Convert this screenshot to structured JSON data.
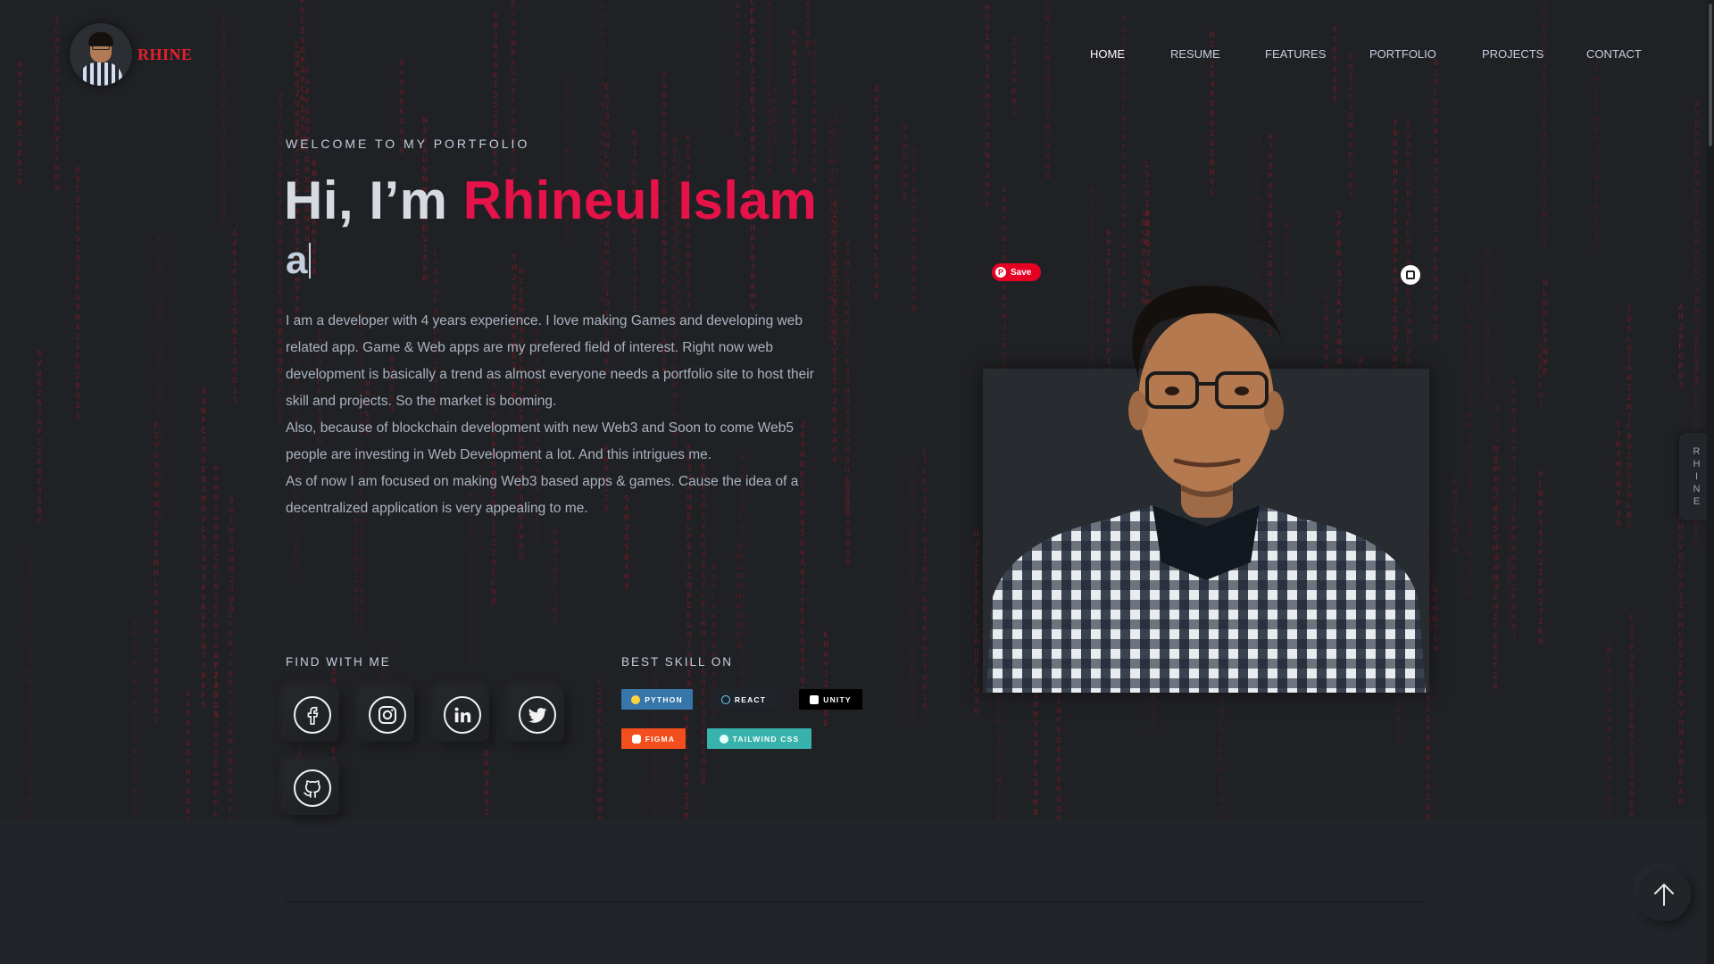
{
  "header": {
    "logo_text": "RHINE",
    "nav": [
      {
        "label": "HOME",
        "active": true
      },
      {
        "label": "RESUME",
        "active": false
      },
      {
        "label": "FEATURES",
        "active": false
      },
      {
        "label": "PORTFOLIO",
        "active": false
      },
      {
        "label": "PROJECTS",
        "active": false
      },
      {
        "label": "CONTACT",
        "active": false
      }
    ]
  },
  "hero": {
    "subtitle": "WELCOME TO MY PORTFOLIO",
    "greeting": "Hi, I’m ",
    "name": "Rhineul Islam",
    "typed_text": "a",
    "bio": [
      "I am a developer with 4 years experience. I love making Games and developing web related app. Game & Web apps are my prefered field of interest. Right now web development is basically a trend as almost everyone needs a portfolio site to host their skill and projects. So the market is booming.",
      "Also, because of blockchain development with new Web3 and Soon to come Web5 people are investing in Web Development a lot. And this intrigues me.",
      "As of now I am focused on making Web3 based apps & games. Cause the idea of a decentralized application is very appealing to me."
    ]
  },
  "find": {
    "title": "FIND WITH ME",
    "icons": [
      "facebook-icon",
      "instagram-icon",
      "linkedin-icon",
      "twitter-icon",
      "github-icon"
    ]
  },
  "skills": {
    "title": "BEST SKILL ON",
    "badges": [
      {
        "label": "PYTHON",
        "color": "#3776ab"
      },
      {
        "label": "REACT",
        "color": "#20232a"
      },
      {
        "label": "UNITY",
        "color": "#000000"
      },
      {
        "label": "FIGMA",
        "color": "#f24e1e"
      },
      {
        "label": "TAILWIND CSS",
        "color": "#38b2ac"
      }
    ]
  },
  "photo": {
    "save_label": "Save"
  },
  "side_tab": {
    "letters": [
      "R",
      "H",
      "I",
      "N",
      "E"
    ]
  },
  "colors": {
    "accent": "#e5134a",
    "logo": "#e8202d",
    "background": "#202124",
    "rain": "#8a1a24"
  }
}
